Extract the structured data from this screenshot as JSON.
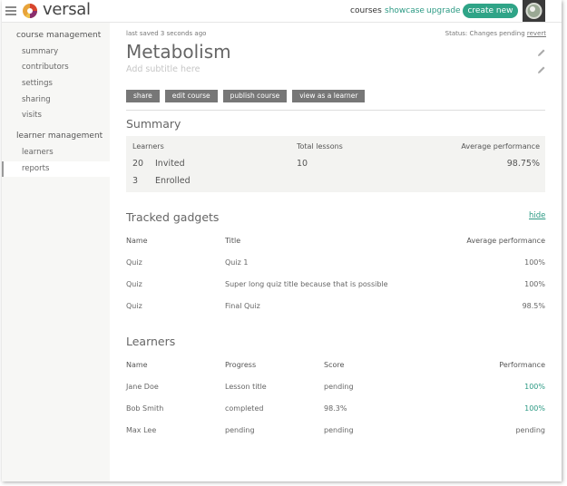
{
  "header": {
    "brand": "versal",
    "nav": {
      "courses": "courses",
      "showcase": "showcase",
      "upgrade": "upgrade"
    },
    "create_button": "create new"
  },
  "sidebar": {
    "course_management": "course management",
    "course_items": [
      "summary",
      "contributors",
      "settings",
      "sharing",
      "visits"
    ],
    "learner_management": "learner management",
    "learner_items": [
      "learners",
      "reports"
    ],
    "active_item": "reports"
  },
  "page": {
    "saved_text": "last saved 3 seconds ago",
    "status_label": "Status: Changes pending",
    "status_revert": "revert",
    "title": "Metabolism",
    "subtitle_placeholder": "Add subtitle here",
    "buttons": [
      "share",
      "edit course",
      "publish course",
      "view as a learner"
    ]
  },
  "summary": {
    "heading": "Summary",
    "col_learners": "Learners",
    "col_lessons": "Total lessons",
    "col_performance": "Average performance",
    "invited_count": "20",
    "invited_label": "Invited",
    "enrolled_count": "3",
    "enrolled_label": "Enrolled",
    "total_lessons": "10",
    "avg_performance": "98.75%"
  },
  "gadgets": {
    "heading": "Tracked gadgets",
    "hide_label": "hide",
    "columns": [
      "Name",
      "Title",
      "Average performance"
    ],
    "rows": [
      {
        "name": "Quiz",
        "title": "Quiz 1",
        "performance": "100%"
      },
      {
        "name": "Quiz",
        "title": "Super long quiz title because that is possible",
        "performance": "100%"
      },
      {
        "name": "Quiz",
        "title": "Final Quiz",
        "performance": "98.5%"
      }
    ]
  },
  "learners": {
    "heading": "Learners",
    "columns": [
      "Name",
      "Progress",
      "Score",
      "Performance"
    ],
    "rows": [
      {
        "name": "Jane Doe",
        "progress": "Lesson title",
        "score": "pending",
        "performance": "100%"
      },
      {
        "name": "Bob Smith",
        "progress": "completed",
        "score": "98.3%",
        "performance": "100%"
      },
      {
        "name": "Max Lee",
        "progress": "pending",
        "score": "pending",
        "performance": "pending"
      }
    ]
  },
  "colors": {
    "accent": "#2fa487",
    "link": "#2c9a84",
    "sidebar_bg": "#f7f7f5",
    "button_bg": "#777777"
  },
  "icons": {
    "menu": "hamburger-icon",
    "logo": "versal-logo",
    "edit": "pencil-icon"
  }
}
